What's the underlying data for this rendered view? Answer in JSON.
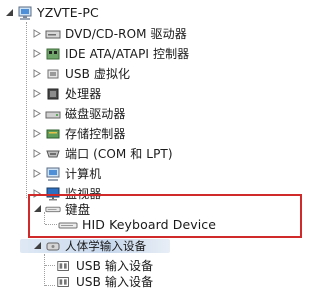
{
  "root": {
    "label": "YZVTE-PC",
    "icon": "computer-icon"
  },
  "categories": [
    {
      "label": "DVD/CD-ROM 驱动器",
      "icon": "dvd-drive-icon"
    },
    {
      "label": "IDE ATA/ATAPI 控制器",
      "icon": "ide-controller-icon"
    },
    {
      "label": "USB 虚拟化",
      "icon": "usb-icon"
    },
    {
      "label": "处理器",
      "icon": "processor-icon"
    },
    {
      "label": "磁盘驱动器",
      "icon": "disk-drive-icon"
    },
    {
      "label": "存储控制器",
      "icon": "storage-controller-icon"
    },
    {
      "label": "端口 (COM 和 LPT)",
      "icon": "port-icon"
    },
    {
      "label": "计算机",
      "icon": "computer-icon"
    },
    {
      "label": "监视器",
      "icon": "monitor-icon"
    }
  ],
  "keyboard": {
    "label": "键盘",
    "icon": "keyboard-icon",
    "device": {
      "label": "HID Keyboard Device",
      "icon": "keyboard-icon"
    }
  },
  "hid_category": {
    "label": "人体学输入设备",
    "icon": "hid-icon"
  },
  "usb_inputs": [
    {
      "label": "USB 输入设备",
      "icon": "hid-device-icon"
    },
    {
      "label": "USB 输入设备",
      "icon": "hid-device-icon"
    }
  ],
  "colors": {
    "highlight": "#d02a2a",
    "tree_line": "#a0a0a0"
  }
}
